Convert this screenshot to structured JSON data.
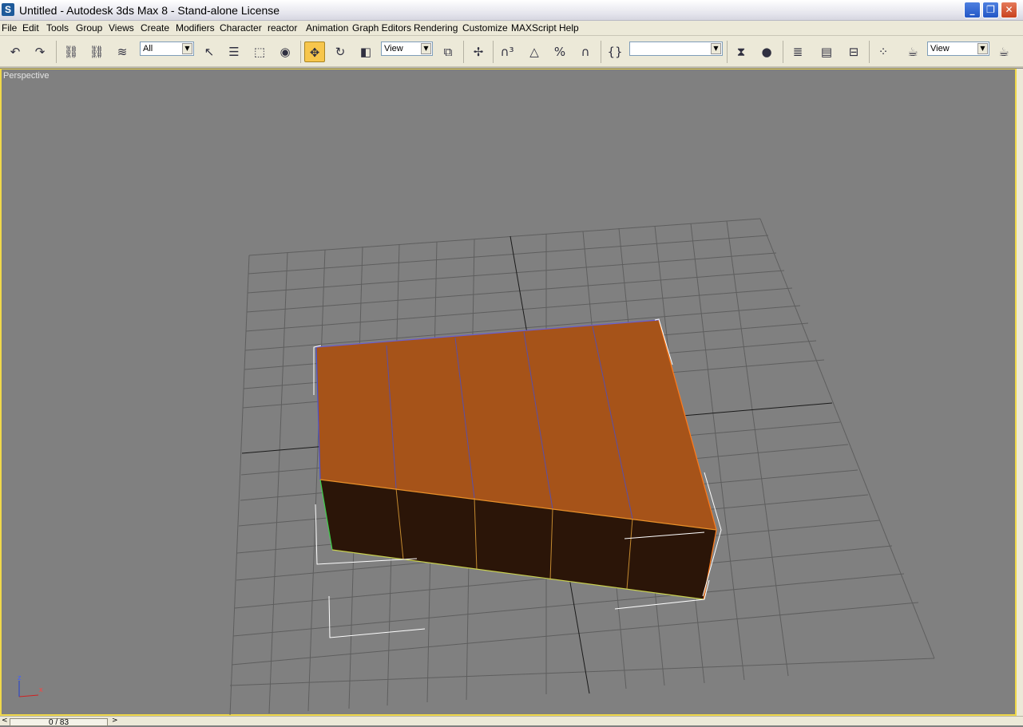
{
  "window": {
    "title": "Untitled - Autodesk 3ds Max 8  - Stand-alone License",
    "app_icon": "S"
  },
  "menu": {
    "items": [
      "File",
      "Edit",
      "Tools",
      "Group",
      "Views",
      "Create",
      "Modifiers",
      "Character",
      "reactor",
      "Animation",
      "Graph Editors",
      "Rendering",
      "Customize",
      "MAXScript",
      "Help"
    ]
  },
  "toolbar": {
    "selection_filter": "All",
    "reference_coord": "View",
    "named_selection": "",
    "render_type": "View"
  },
  "viewport": {
    "label": "Perspective",
    "axis_z": "z",
    "axis_x": "x"
  },
  "timeline": {
    "frame_counter": "0 / 83",
    "prev_arrow": "<",
    "next_arrow": ">"
  },
  "colors": {
    "viewport_bg": "#808080",
    "active_border": "#f0d84a",
    "box_top": "#a65319",
    "box_side": "#2b1508",
    "grid_line": "#5e5e5e"
  }
}
